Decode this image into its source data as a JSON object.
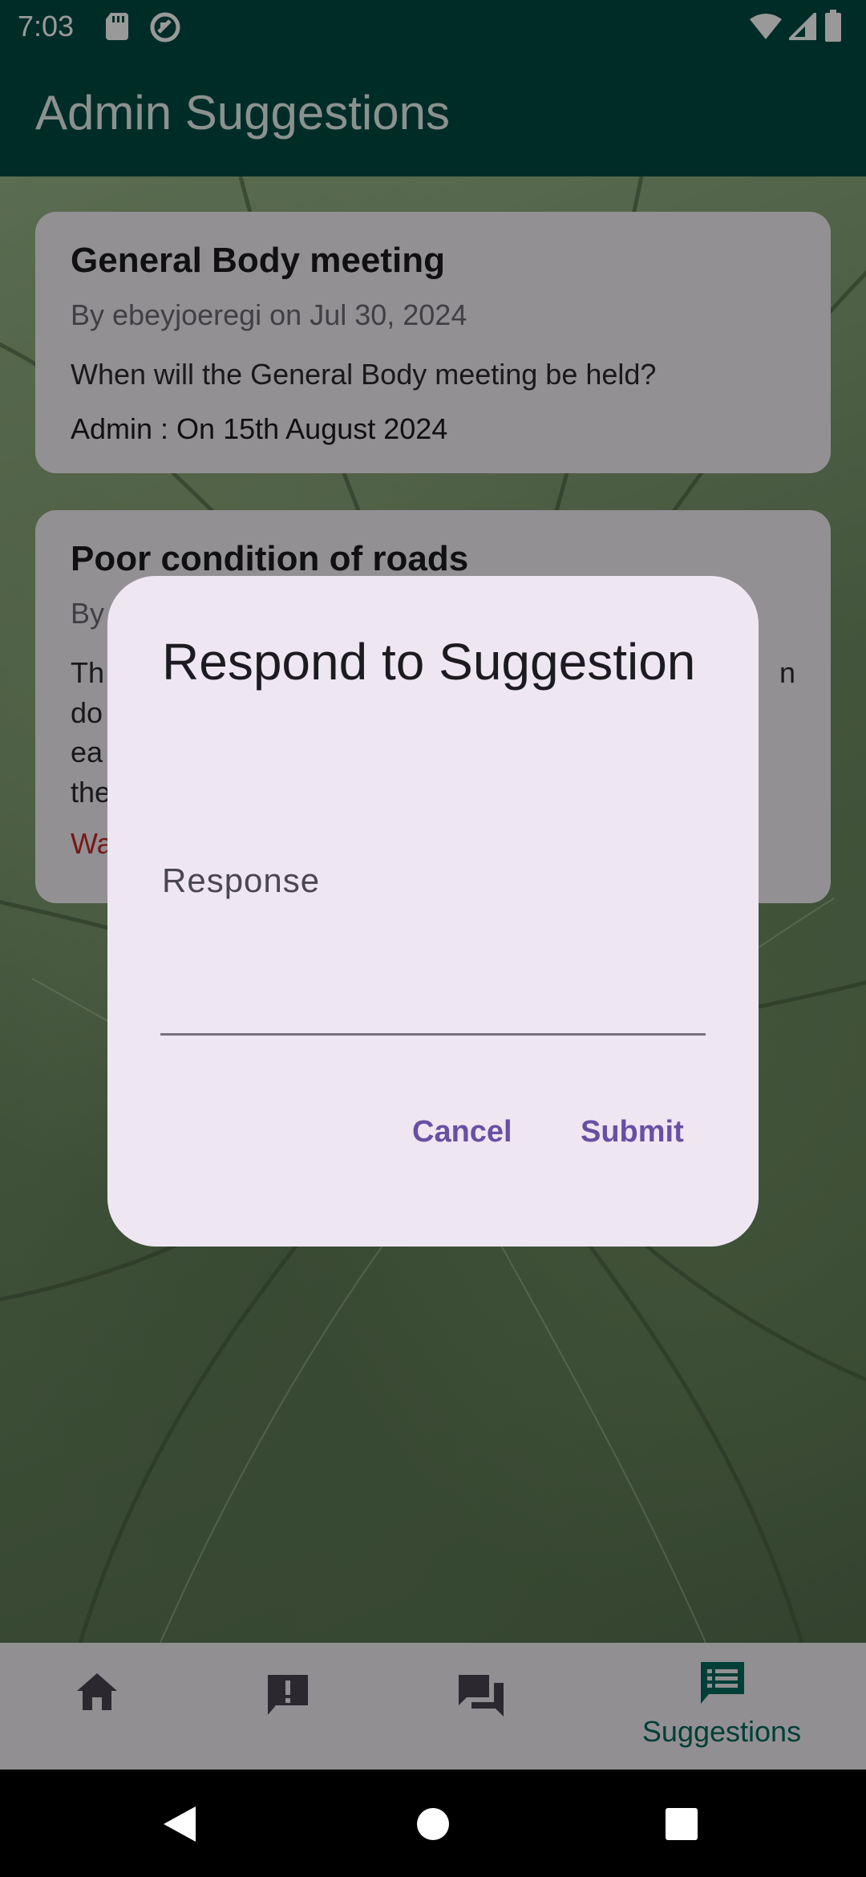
{
  "status_bar": {
    "time": "7:03",
    "icons": [
      "sd-card-icon",
      "sync-circle-icon",
      "wifi-icon",
      "signal-icon",
      "battery-icon"
    ]
  },
  "app_bar": {
    "title": "Admin Suggestions"
  },
  "cards": [
    {
      "title": "General Body meeting",
      "meta": "By ebeyjoeregi on Jul 30, 2024",
      "body": "When will the General Body meeting be held?",
      "admin": "Admin : On 15th August 2024"
    },
    {
      "title": "Poor condition of roads",
      "meta": "By",
      "body_lines": [
        "Th",
        "do",
        "ea",
        "the"
      ],
      "body_right": "n",
      "warning": "Wa"
    }
  ],
  "bottom_nav": {
    "items": [
      {
        "icon": "home-icon",
        "label": ""
      },
      {
        "icon": "report-icon",
        "label": ""
      },
      {
        "icon": "forum-icon",
        "label": ""
      },
      {
        "icon": "suggestions-icon",
        "label": "Suggestions"
      }
    ],
    "active_color": "#00695c"
  },
  "dialog": {
    "title": "Respond to Suggestion",
    "field_label": "Response",
    "field_value": "",
    "cancel_label": "Cancel",
    "submit_label": "Submit",
    "accent": "#6750a4"
  },
  "system_nav": {
    "icons": [
      "back-icon",
      "home-circle-icon",
      "recents-icon"
    ]
  }
}
